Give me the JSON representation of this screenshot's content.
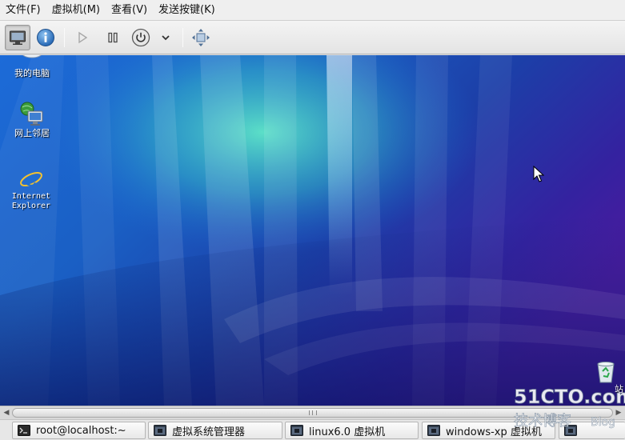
{
  "menubar": {
    "items": [
      {
        "label": "文件(F)"
      },
      {
        "label": "虚拟机(M)"
      },
      {
        "label": "查看(V)"
      },
      {
        "label": "发送按键(K)"
      }
    ]
  },
  "toolbar": {
    "buttons": [
      {
        "icon": "console-icon",
        "active": true
      },
      {
        "icon": "details-info-icon",
        "active": false
      },
      {
        "icon": "run-play-icon",
        "active": false
      },
      {
        "icon": "pause-icon",
        "active": false
      },
      {
        "icon": "power-icon",
        "active": false
      },
      {
        "icon": "chevron-down-icon",
        "active": false
      },
      {
        "icon": "fullscreen-resize-icon",
        "active": false
      }
    ]
  },
  "desktop": {
    "icons": [
      {
        "label": "我的电脑",
        "icon": "my-computer-icon"
      },
      {
        "label": "网上邻居",
        "icon": "network-places-icon"
      },
      {
        "label": "Internet\nExplorer",
        "icon": "internet-explorer-icon"
      },
      {
        "label": "站",
        "icon": "recycle-bin-icon"
      }
    ]
  },
  "taskbar": {
    "tasks": [
      {
        "label": "root@localhost:~",
        "icon": "terminal-icon"
      },
      {
        "label": "虚拟系统管理器",
        "icon": "vm-window-icon"
      },
      {
        "label": "linux6.0 虚拟机",
        "icon": "vm-window-icon"
      },
      {
        "label": "windows-xp 虚拟机",
        "icon": "vm-window-icon"
      },
      {
        "label": "",
        "icon": "vm-window-icon"
      }
    ]
  },
  "watermark": {
    "brand": "51CTO.com",
    "line2": "技术博客",
    "line3": "Blog"
  },
  "colors": {
    "menubar_bg": "#efefef",
    "toolbar_bg": "#e8e8e8",
    "desktop_blue": "#1b4fb8",
    "desktop_purple": "#3a1f9a",
    "desktop_teal": "#3fd1c0"
  }
}
